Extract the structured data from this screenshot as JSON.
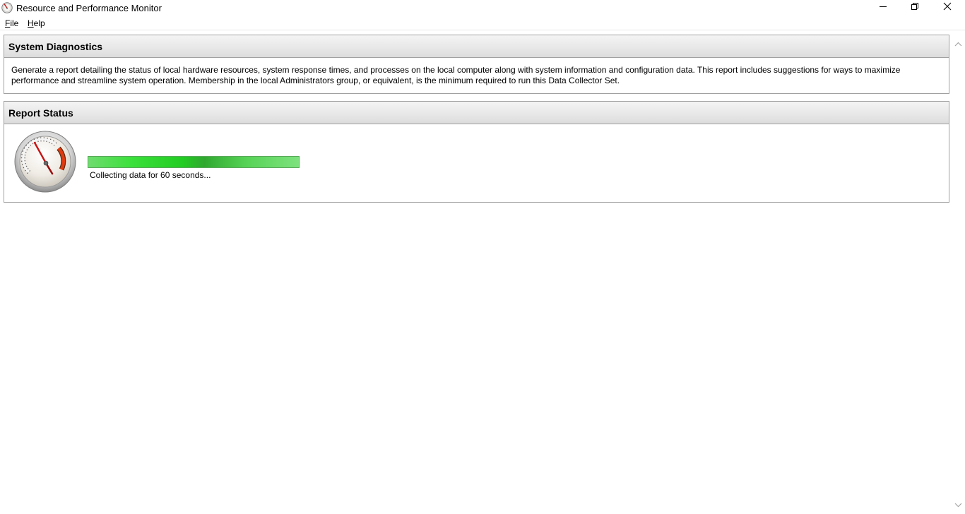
{
  "window": {
    "title": "Resource and Performance Monitor",
    "icon": "performance-monitor-icon",
    "controls": [
      "minimize-icon",
      "restore-icon",
      "close-icon"
    ]
  },
  "menu": {
    "file": {
      "accel": "F",
      "rest": "ile"
    },
    "help": {
      "accel": "H",
      "rest": "elp"
    }
  },
  "diagnostics": {
    "title": "System Diagnostics",
    "description": "Generate a report detailing the status of local hardware resources, system response times, and processes on the local computer along with system information and configuration data. This report includes suggestions for ways to maximize performance and streamline system operation. Membership in the local Administrators group, or equivalent, is the minimum required to run this Data Collector Set."
  },
  "report_status": {
    "title": "Report Status",
    "icon": "gauge-icon",
    "progress_style": "marquee",
    "progress_fraction": 1.0,
    "status_text": "Collecting data for 60 seconds..."
  },
  "colors": {
    "progress_green": "#22cc22",
    "panel_border": "#a0a0a0",
    "gauge_needle": "#cc1111"
  }
}
